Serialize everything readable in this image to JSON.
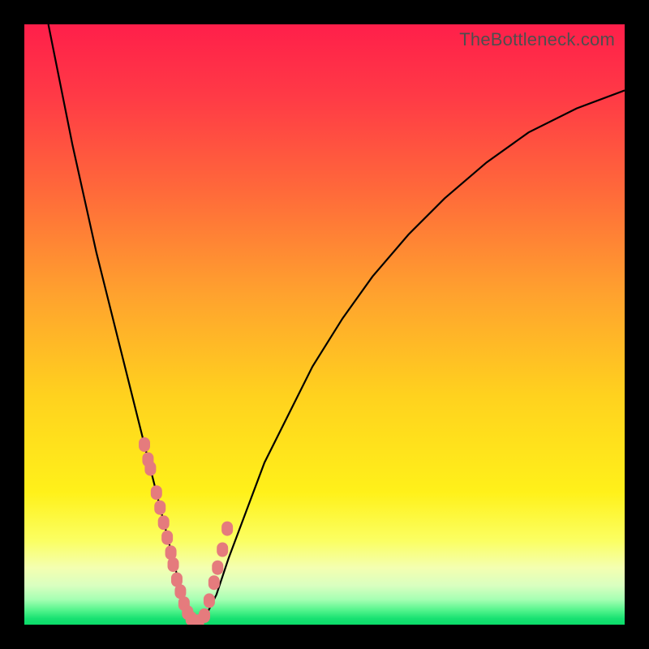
{
  "watermark": "TheBottleneck.com",
  "colors": {
    "frame": "#000000",
    "curve_stroke": "#000000",
    "marker_fill": "#e57b7d",
    "gradient_stops": [
      {
        "offset": 0.0,
        "color": "#ff1f4a"
      },
      {
        "offset": 0.12,
        "color": "#ff3a46"
      },
      {
        "offset": 0.28,
        "color": "#ff6a3a"
      },
      {
        "offset": 0.45,
        "color": "#ffa22e"
      },
      {
        "offset": 0.62,
        "color": "#ffd21e"
      },
      {
        "offset": 0.78,
        "color": "#fff11a"
      },
      {
        "offset": 0.86,
        "color": "#fbff62"
      },
      {
        "offset": 0.905,
        "color": "#f4ffb0"
      },
      {
        "offset": 0.935,
        "color": "#d9ffc0"
      },
      {
        "offset": 0.958,
        "color": "#a6ffb3"
      },
      {
        "offset": 0.975,
        "color": "#58f58e"
      },
      {
        "offset": 0.99,
        "color": "#17e171"
      },
      {
        "offset": 1.0,
        "color": "#0bdc6a"
      }
    ]
  },
  "chart_data": {
    "type": "line",
    "title": "",
    "xlabel": "",
    "ylabel": "",
    "xlim": [
      0,
      100
    ],
    "ylim": [
      0,
      100
    ],
    "grid": false,
    "series": [
      {
        "name": "bottleneck-curve",
        "x": [
          4,
          6,
          8,
          10,
          12,
          14,
          16,
          18,
          20,
          21,
          22,
          23,
          24,
          25,
          26,
          27,
          28,
          29,
          30,
          32,
          34,
          37,
          40,
          44,
          48,
          53,
          58,
          64,
          70,
          77,
          84,
          92,
          100
        ],
        "y": [
          100,
          90,
          80,
          71,
          62,
          54,
          46,
          38,
          30,
          26,
          22,
          18,
          14,
          10,
          6,
          3,
          1,
          0,
          1,
          5,
          11,
          19,
          27,
          35,
          43,
          51,
          58,
          65,
          71,
          77,
          82,
          86,
          89
        ]
      }
    ],
    "markers": {
      "name": "highlight-points",
      "x": [
        20.0,
        20.6,
        21.0,
        22.0,
        22.6,
        23.2,
        23.8,
        24.4,
        24.8,
        25.4,
        26.0,
        26.6,
        27.2,
        27.8,
        28.4,
        29.0,
        30.0,
        30.8,
        31.6,
        32.2,
        33.0,
        33.8
      ],
      "y": [
        30,
        27.5,
        26,
        22,
        19.5,
        17,
        14.5,
        12,
        10,
        7.5,
        5.5,
        3.5,
        2,
        1,
        0.5,
        0.5,
        1.5,
        4,
        7,
        9.5,
        12.5,
        16
      ]
    }
  }
}
